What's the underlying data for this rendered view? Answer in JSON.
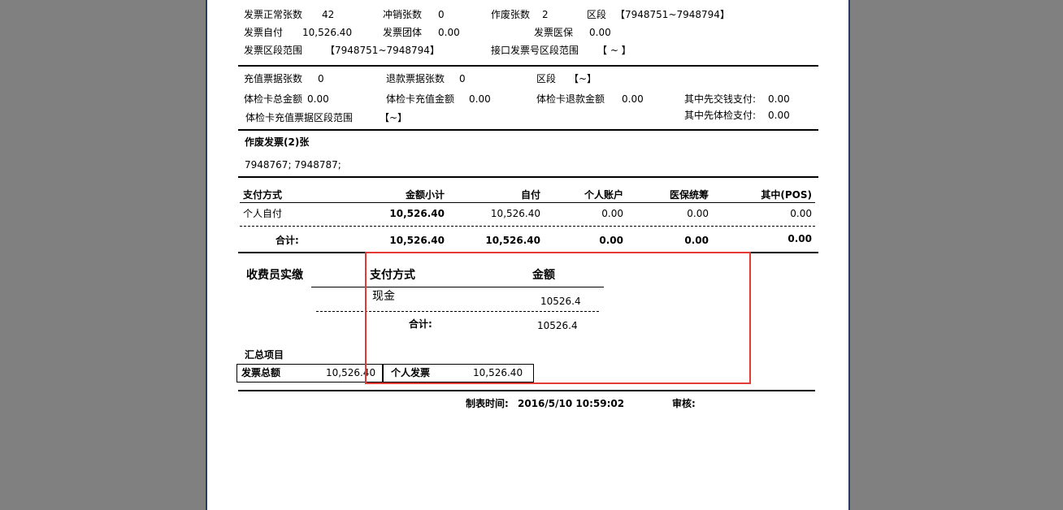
{
  "summary": {
    "normal_count_label": "发票正常张数",
    "normal_count": "42",
    "reversal_count_label": "冲销张数",
    "reversal_count": "0",
    "void_count_label": "作废张数",
    "void_count": "2",
    "segment_label": "区段",
    "segment": "【7948751~7948794】",
    "self_pay_label": "发票自付",
    "self_pay": "10,526.40",
    "group_label": "发票团体",
    "group": "0.00",
    "medical_label": "发票医保",
    "medical": "0.00",
    "range_label": "发票区段范围",
    "range": "【7948751~7948794】",
    "interface_range_label": "接口发票号区段范围",
    "interface_range": "【 ~ 】"
  },
  "card": {
    "recharge_count_label": "充值票据张数",
    "recharge_count": "0",
    "refund_count_label": "退款票据张数",
    "refund_count": "0",
    "segment_label": "区段",
    "segment": "【~】",
    "total_label": "体检卡总金额",
    "total": "0.00",
    "recharge_amount_label": "体检卡充值金额",
    "recharge_amount": "0.00",
    "refund_amount_label": "体检卡退款金额",
    "refund_amount": "0.00",
    "prepay_label": "其中先交钱支付:",
    "prepay": "0.00",
    "precheck_label": "其中先体检支付:",
    "precheck": "0.00",
    "recharge_range_label": "体检卡充值票据区段范围",
    "recharge_range": "【~】"
  },
  "void": {
    "title": "作废发票(2)张",
    "numbers": "7948767; 7948787;"
  },
  "payment_table": {
    "headers": [
      "支付方式",
      "金额小计",
      "自付",
      "个人账户",
      "医保统筹",
      "其中(POS)"
    ],
    "row": [
      "个人自付",
      "10,526.40",
      "10,526.40",
      "0.00",
      "0.00",
      "0.00"
    ],
    "total": [
      "合计:",
      "10,526.40",
      "10,526.40",
      "0.00",
      "0.00",
      "0.00"
    ]
  },
  "cashier": {
    "title": "收费员实缴",
    "header_method": "支付方式",
    "header_amount": "金额",
    "method": "现金",
    "amount": "10526.4",
    "total_label": "合计:",
    "total": "10526.4"
  },
  "items": {
    "title": "汇总项目",
    "invoice_total_label": "发票总额",
    "invoice_total": "10,526.40",
    "personal_invoice_label": "个人发票",
    "personal_invoice": "10,526.40"
  },
  "footer": {
    "made_time_label": "制表时间:",
    "made_time": "2016/5/10 10:59:02",
    "audit_label": "审核:"
  },
  "colors": {
    "background": "#808080",
    "highlight": "#e53935",
    "page_border": "#2a3a66"
  }
}
